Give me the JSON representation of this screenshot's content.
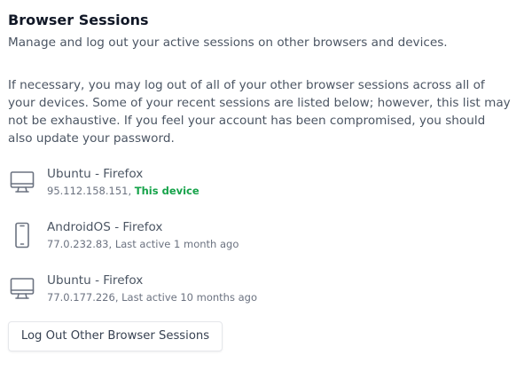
{
  "section": {
    "title": "Browser Sessions",
    "subtitle": "Manage and log out your active sessions on other browsers and devices.",
    "description": "If necessary, you may log out of all of your other browser sessions across all of your devices. Some of your recent sessions are listed below; however, this list may not be exhaustive. If you feel your account has been compromised, you should also update your password."
  },
  "sessions": [
    {
      "icon": "desktop-icon",
      "name": "Ubuntu - Firefox",
      "ip": "95.112.158.151,",
      "status": "This device"
    },
    {
      "icon": "mobile-icon",
      "name": "AndroidOS - Firefox",
      "ip": "77.0.232.83,",
      "status": "Last active 1 month ago"
    },
    {
      "icon": "desktop-icon",
      "name": "Ubuntu - Firefox",
      "ip": "77.0.177.226,",
      "status": "Last active 10 months ago"
    }
  ],
  "actions": {
    "logout_label": "Log Out Other Browser Sessions"
  },
  "colors": {
    "this_device": "#16a34a",
    "icon": "#6b7280"
  }
}
